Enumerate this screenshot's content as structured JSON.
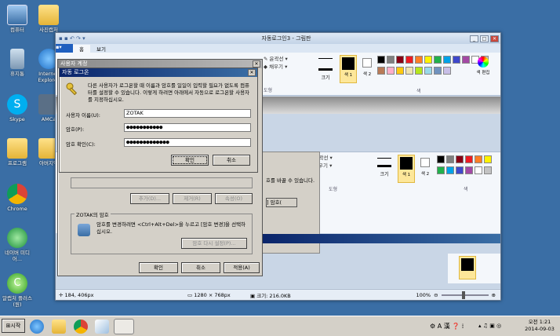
{
  "desktop": {
    "icons": [
      {
        "label": "컴퓨터"
      },
      {
        "label": "사진캡처"
      },
      {
        "label": "휴지통"
      },
      {
        "label": "Internet Explorer"
      },
      {
        "label": "Skype"
      },
      {
        "label": "AMCa"
      },
      {
        "label": "프로그램"
      },
      {
        "label": "아버지약"
      },
      {
        "label": "Chrome"
      },
      {
        "label": "네이버 미디어..."
      },
      {
        "label": "알캡처 플러스(원)"
      }
    ]
  },
  "paint": {
    "title": "자동로그인3 - 그림판",
    "tabs": [
      "홈",
      "보기"
    ],
    "ribbon": {
      "outline": "윤곽선",
      "fill": "채우기",
      "shapes": "도형",
      "size": "크기",
      "color1": "색 1",
      "color2": "색 2",
      "colors": "색",
      "edit_colors": "색 편집"
    },
    "inner": {
      "text_fragment": "호를 바꿀 수 있습니다.",
      "btn_fragment": "] 암호(",
      "shapes": "도형",
      "size": "크기",
      "color1": "색 1",
      "color2": "색 2",
      "colors": "색",
      "outline": "윤곽선",
      "fill": "채우기"
    },
    "status": {
      "cursor": "184, 406px",
      "dimensions": "1280 × 768px",
      "filesize": "크기: 216.0KB",
      "zoom": "100%"
    },
    "palette": [
      "#000000",
      "#7f7f7f",
      "#880015",
      "#ed1c24",
      "#ff7f27",
      "#fff200",
      "#22b14c",
      "#00a2e8",
      "#3f48cc",
      "#a349a4",
      "#ffffff",
      "#c3c3c3",
      "#b97a57",
      "#ffaec9",
      "#ffc90e",
      "#efe4b0",
      "#b5e61d",
      "#99d9ea",
      "#7092be",
      "#c8bfe7"
    ]
  },
  "user_accounts": {
    "title": "사용자 계정",
    "buttons": {
      "add": "추가(D)...",
      "remove": "제거(R)",
      "properties": "속성(O)"
    },
    "group_title": "ZOTAK의 암호",
    "group_text": "암호를 변경하려면 <Ctrl+Alt+Del>을 누르고 [암호 변경]을 선택하십시오.",
    "reset_btn": "암호 다시 설정(P)...",
    "ok": "확인",
    "cancel": "취소",
    "apply": "적용(A)"
  },
  "auto_logon": {
    "title": "자동 로그온",
    "description": "다른 사용자가 로그온할 때 이름과 암호를 일일이 입력할 필요가 없도록 컴퓨터를 설정할 수 있습니다. 이렇게 하려면 아래에서 자동으로 로그온할 사용자를 지정하십시오.",
    "username_label": "사용자 이름(U):",
    "username_value": "ZOTAK",
    "password_label": "암호(P):",
    "password_value": "●●●●●●●●●●●",
    "confirm_label": "암호 확인(C):",
    "confirm_value": "●●●●●●●●●●●●●",
    "ok": "확인",
    "cancel": "취소"
  },
  "taskbar": {
    "start": "시작",
    "lang": "A 漢",
    "time": "오전 1:21",
    "date": "2014-09-03"
  }
}
